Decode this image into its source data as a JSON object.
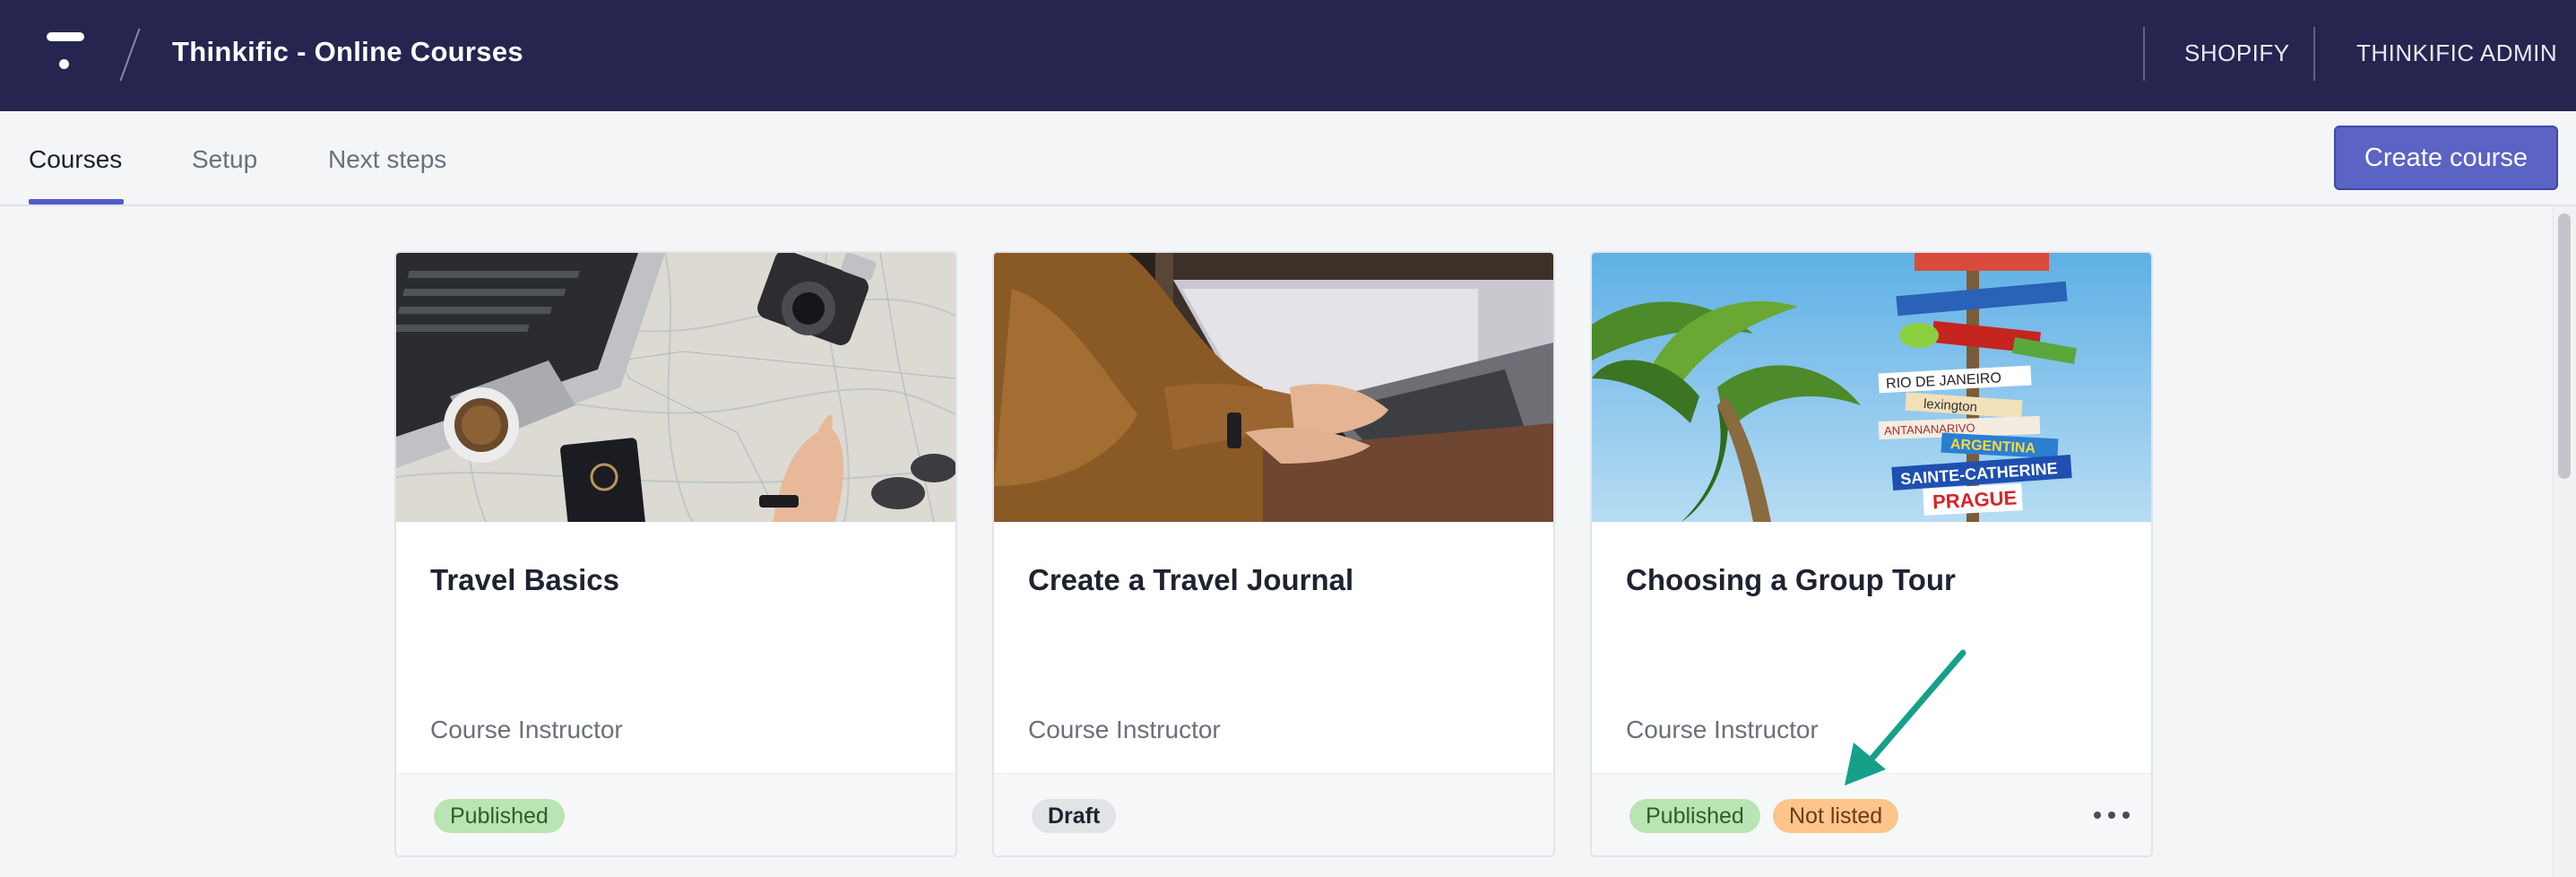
{
  "topbar": {
    "app_title": "Thinkific - Online Courses",
    "logo_icon": "thinkific-logo-icon",
    "links": [
      "SHOPIFY",
      "THINKIFIC ADMIN"
    ],
    "background": "#262550"
  },
  "tabs": [
    {
      "label": "Courses",
      "active": true
    },
    {
      "label": "Setup",
      "active": false
    },
    {
      "label": "Next steps",
      "active": false
    }
  ],
  "create_button": {
    "label": "Create course",
    "color": "#5b63c4"
  },
  "courses": [
    {
      "title": "Travel Basics",
      "instructor": "Course Instructor",
      "badges": [
        "Published"
      ],
      "image": "laptop-map-camera-passport-photo"
    },
    {
      "title": "Create a Travel Journal",
      "instructor": "Course Instructor",
      "badges": [
        "Draft"
      ],
      "image": "typing-on-laptop-photo"
    },
    {
      "title": "Choosing a Group Tour",
      "instructor": "Course Instructor",
      "badges": [
        "Published",
        "Not listed"
      ],
      "image": "palm-tree-signpost-photo",
      "signpost_text": [
        "RIO DE JANEIRO",
        "lexington",
        "ANTANANARIVO",
        "ARGENTINA",
        "SAINTE-CATHERINE",
        "PRAGUE"
      ],
      "more_icon": "more-horizontal-icon"
    }
  ],
  "annotation": {
    "arrow_color": "#16a08a",
    "icon": "arrow-pointer-icon"
  },
  "colors": {
    "published_badge": "#b9e4b3",
    "draft_badge": "#e2e3e7",
    "not_listed_badge": "#fbc58c",
    "active_tab_underline": "#4f5cc4"
  }
}
